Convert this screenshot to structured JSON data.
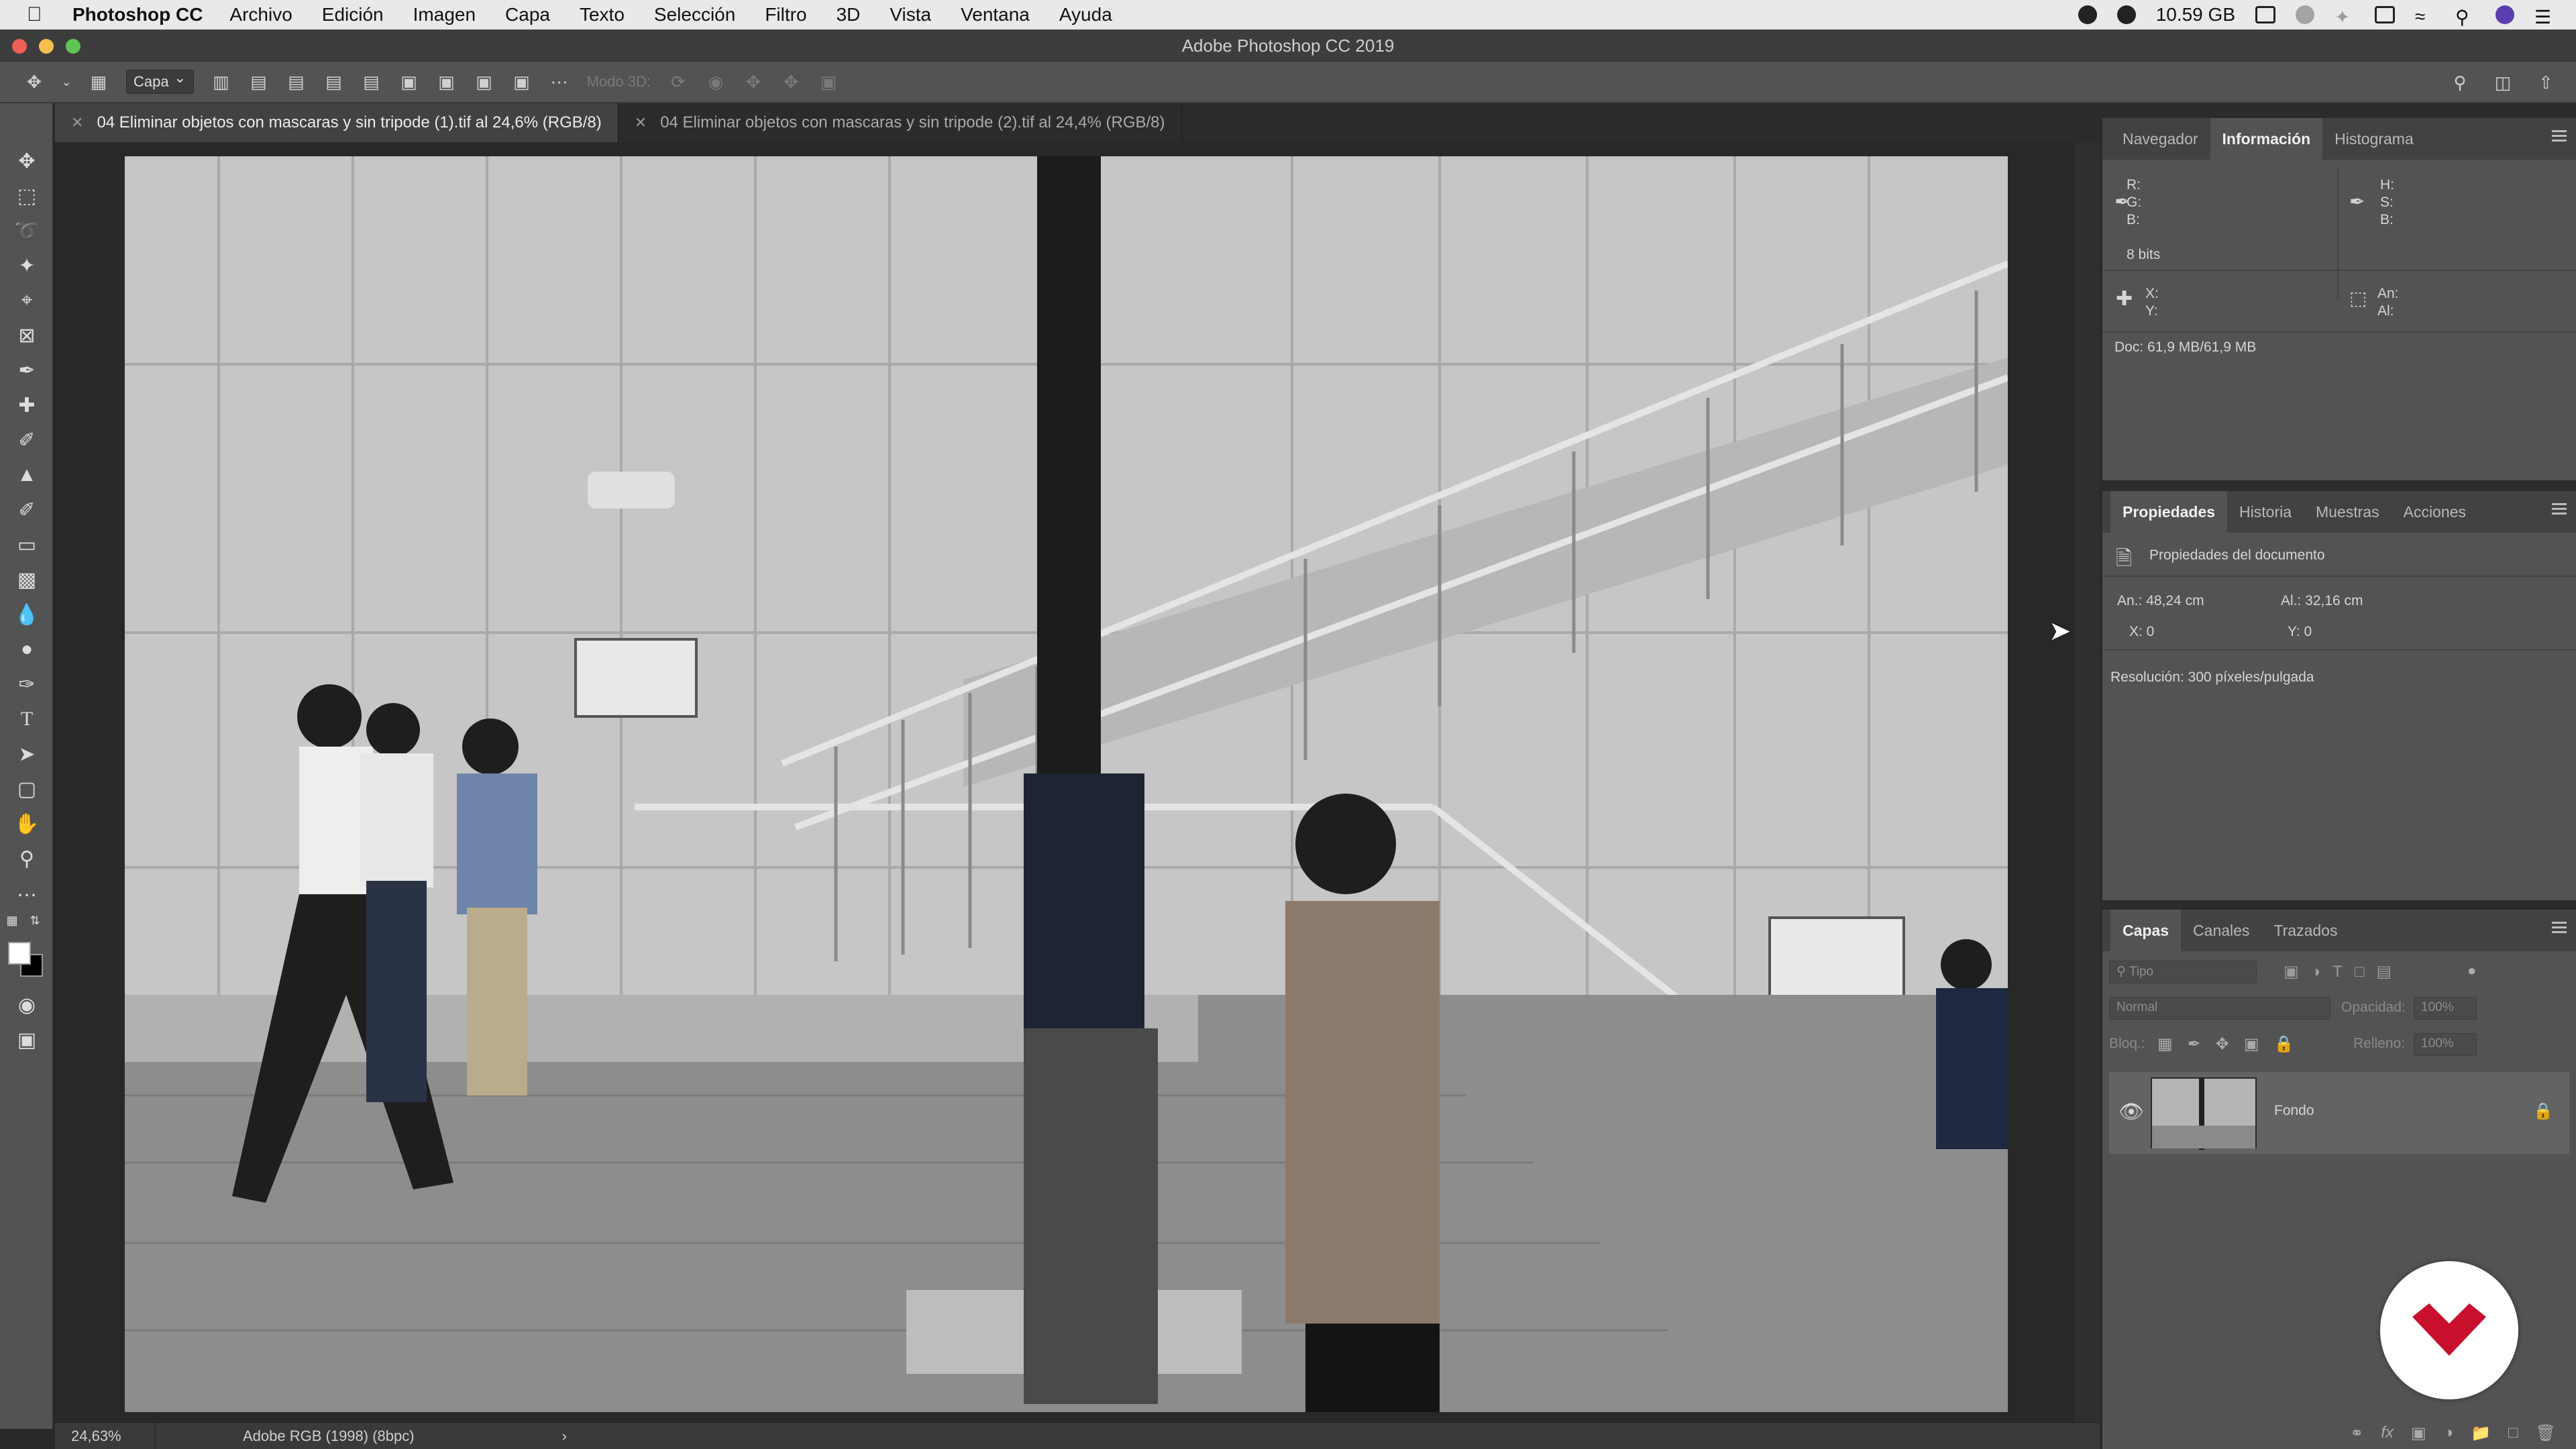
{
  "menubar": {
    "app": "Photoshop CC",
    "items": [
      "Archivo",
      "Edición",
      "Imagen",
      "Capa",
      "Texto",
      "Selección",
      "Filtro",
      "3D",
      "Vista",
      "Ventana",
      "Ayuda"
    ],
    "memory": "10.59 GB"
  },
  "window": {
    "title": "Adobe Photoshop CC 2019"
  },
  "options": {
    "layer_select": "Capa",
    "mode3d": "Modo 3D:"
  },
  "tabs": [
    {
      "label": "04 Eliminar objetos con mascaras y sin tripode (1).tif al 24,6% (RGB/8)"
    },
    {
      "label": "04 Eliminar objetos con mascaras y sin tripode (2).tif al 24,4% (RGB/8)"
    }
  ],
  "status": {
    "zoom": "24,63%",
    "profile": "Adobe RGB (1998) (8bpc)"
  },
  "info_panel": {
    "tabs": [
      "Navegador",
      "Información",
      "Histograma"
    ],
    "rgb": [
      "R:",
      "G:",
      "B:"
    ],
    "hsb": [
      "H:",
      "S:",
      "B:"
    ],
    "bits": "8 bits",
    "xy": [
      "X:",
      "Y:"
    ],
    "size": [
      "An:",
      "Al:"
    ],
    "doc": "Doc: 61,9 MB/61,9 MB"
  },
  "properties_panel": {
    "tabs": [
      "Propiedades",
      "Historia",
      "Muestras",
      "Acciones"
    ],
    "title": "Propiedades del documento",
    "width": "An.: 48,24 cm",
    "height": "Al.: 32,16 cm",
    "x": "X: 0",
    "y": "Y: 0",
    "resolution": "Resolución: 300 píxeles/pulgada"
  },
  "layers_panel": {
    "tabs": [
      "Capas",
      "Canales",
      "Trazados"
    ],
    "search_placeholder": "Tipo",
    "blend": "Normal",
    "opacity_label": "Opacidad:",
    "opacity": "100%",
    "lock_label": "Bloq.:",
    "fill_label": "Relleno:",
    "fill": "100%",
    "layer_name": "Fondo"
  },
  "colors": {
    "accent": "#c8102e",
    "panel": "#535353",
    "dark": "#282828"
  }
}
